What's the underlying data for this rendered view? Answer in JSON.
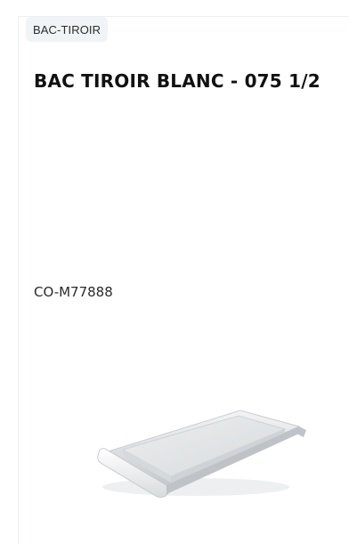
{
  "product": {
    "category": "BAC-TIROIR",
    "title": "BAC TIROIR BLANC - 075 1/2",
    "reference": "CO-M77888",
    "image_icon": "white-drawer-tray-image"
  }
}
